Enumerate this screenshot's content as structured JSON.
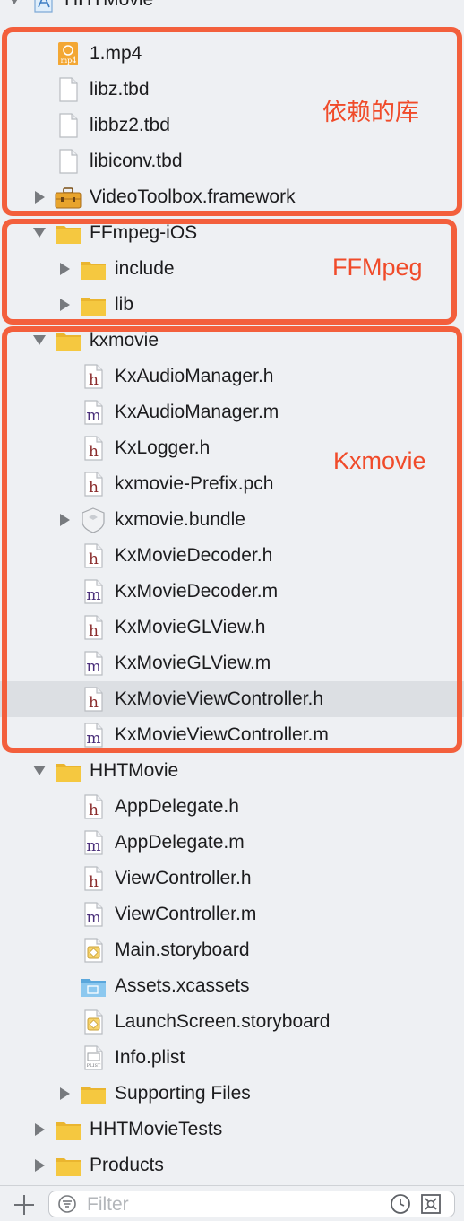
{
  "tree": {
    "rows": [
      {
        "name": "HHTMovie",
        "level": 0,
        "icon": "xcode-project-icon",
        "disclosure": "down"
      },
      {
        "name": "1.mp4",
        "level": 1,
        "icon": "mp4-file-icon",
        "disclosure": "none"
      },
      {
        "name": "libz.tbd",
        "level": 1,
        "icon": "blank-file-icon",
        "disclosure": "none"
      },
      {
        "name": "libbz2.tbd",
        "level": 1,
        "icon": "blank-file-icon",
        "disclosure": "none"
      },
      {
        "name": "libiconv.tbd",
        "level": 1,
        "icon": "blank-file-icon",
        "disclosure": "none"
      },
      {
        "name": "VideoToolbox.framework",
        "level": 1,
        "icon": "framework-toolbox-icon",
        "disclosure": "right"
      },
      {
        "name": "FFmpeg-iOS",
        "level": 1,
        "icon": "folder-icon",
        "disclosure": "down"
      },
      {
        "name": "include",
        "level": 2,
        "icon": "folder-icon",
        "disclosure": "right"
      },
      {
        "name": "lib",
        "level": 2,
        "icon": "folder-icon",
        "disclosure": "right"
      },
      {
        "name": "kxmovie",
        "level": 1,
        "icon": "folder-icon",
        "disclosure": "down"
      },
      {
        "name": "KxAudioManager.h",
        "level": 2,
        "icon": "header-file-icon",
        "disclosure": "none"
      },
      {
        "name": "KxAudioManager.m",
        "level": 2,
        "icon": "objc-file-icon",
        "disclosure": "none"
      },
      {
        "name": "KxLogger.h",
        "level": 2,
        "icon": "header-file-icon",
        "disclosure": "none"
      },
      {
        "name": "kxmovie-Prefix.pch",
        "level": 2,
        "icon": "header-file-icon",
        "disclosure": "none"
      },
      {
        "name": "kxmovie.bundle",
        "level": 2,
        "icon": "bundle-icon",
        "disclosure": "right"
      },
      {
        "name": "KxMovieDecoder.h",
        "level": 2,
        "icon": "header-file-icon",
        "disclosure": "none"
      },
      {
        "name": "KxMovieDecoder.m",
        "level": 2,
        "icon": "objc-file-icon",
        "disclosure": "none"
      },
      {
        "name": "KxMovieGLView.h",
        "level": 2,
        "icon": "header-file-icon",
        "disclosure": "none"
      },
      {
        "name": "KxMovieGLView.m",
        "level": 2,
        "icon": "objc-file-icon",
        "disclosure": "none"
      },
      {
        "name": "KxMovieViewController.h",
        "level": 2,
        "icon": "header-file-icon",
        "disclosure": "none",
        "selected": true
      },
      {
        "name": "KxMovieViewController.m",
        "level": 2,
        "icon": "objc-file-icon",
        "disclosure": "none"
      },
      {
        "name": "HHTMovie",
        "level": 1,
        "icon": "folder-icon",
        "disclosure": "down"
      },
      {
        "name": "AppDelegate.h",
        "level": 2,
        "icon": "header-file-icon",
        "disclosure": "none"
      },
      {
        "name": "AppDelegate.m",
        "level": 2,
        "icon": "objc-file-icon",
        "disclosure": "none"
      },
      {
        "name": "ViewController.h",
        "level": 2,
        "icon": "header-file-icon",
        "disclosure": "none"
      },
      {
        "name": "ViewController.m",
        "level": 2,
        "icon": "objc-file-icon",
        "disclosure": "none"
      },
      {
        "name": "Main.storyboard",
        "level": 2,
        "icon": "storyboard-icon",
        "disclosure": "none"
      },
      {
        "name": "Assets.xcassets",
        "level": 2,
        "icon": "asset-catalog-icon",
        "disclosure": "none"
      },
      {
        "name": "LaunchScreen.storyboard",
        "level": 2,
        "icon": "storyboard-icon",
        "disclosure": "none"
      },
      {
        "name": "Info.plist",
        "level": 2,
        "icon": "plist-file-icon",
        "disclosure": "none"
      },
      {
        "name": "Supporting Files",
        "level": 2,
        "icon": "folder-icon",
        "disclosure": "right"
      },
      {
        "name": "HHTMovieTests",
        "level": 1,
        "icon": "folder-icon",
        "disclosure": "right"
      },
      {
        "name": "Products",
        "level": 1,
        "icon": "folder-icon",
        "disclosure": "right"
      }
    ]
  },
  "annotations": {
    "libs": "依赖的库",
    "ffmpeg": "FFMpeg",
    "kxmovie": "Kxmovie"
  },
  "icon_glyphs": {
    "header": "h",
    "objc": "m",
    "mp4": "mp4",
    "plist": "PLIST"
  },
  "filter": {
    "placeholder": "Filter",
    "value": ""
  },
  "colors": {
    "annotation": "#f35f3c",
    "annotation_text": "#f04b2a",
    "folder": "#f5c840",
    "header_glyph": "#8a2b2b",
    "objc_glyph": "#4a2f7a",
    "selection": "#dcdfe3"
  }
}
